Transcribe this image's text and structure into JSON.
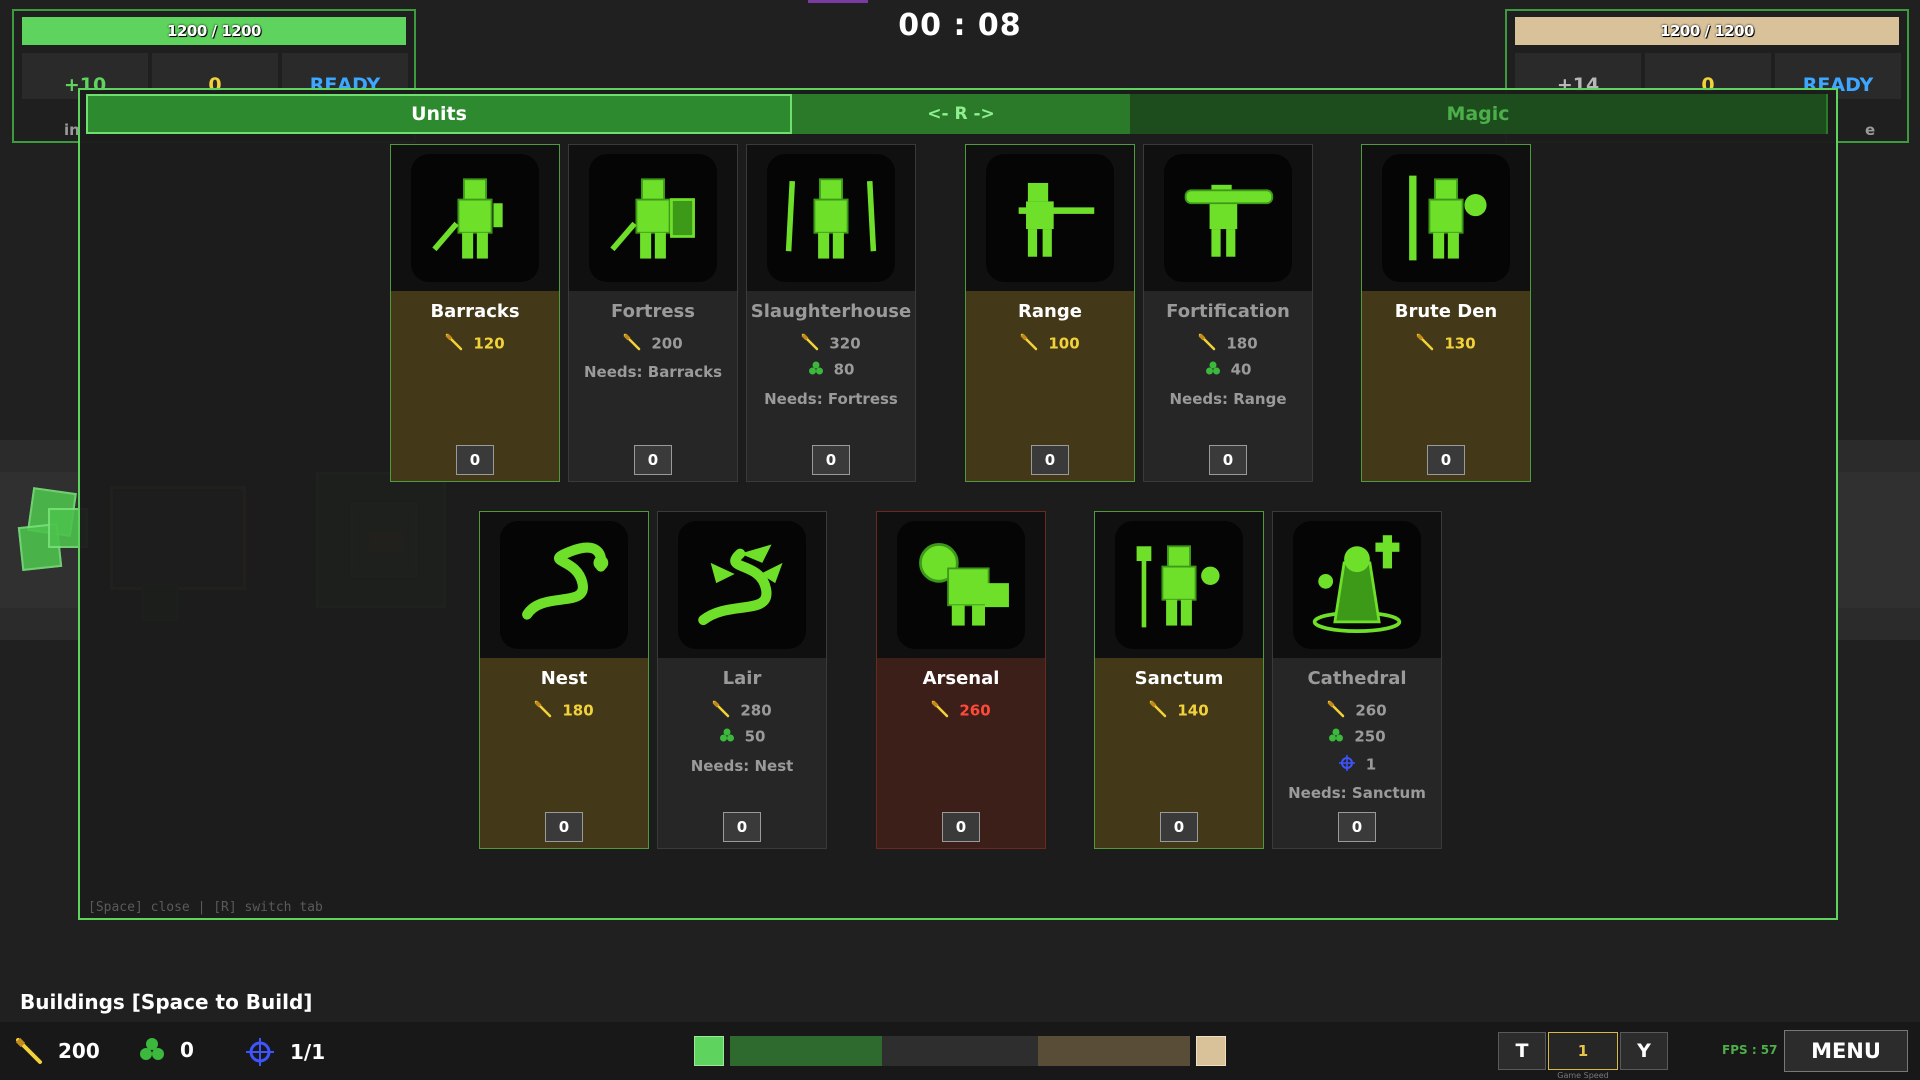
{
  "timer": "00 : 08",
  "player_left": {
    "hp_text": "1200 / 1200",
    "hp_color": "#5ed35e",
    "income": "+10",
    "resource": "0",
    "status": "READY",
    "cut_label": "in"
  },
  "player_right": {
    "hp_text": "1200 / 1200",
    "hp_color": "#d9c29a",
    "income": "+14",
    "resource": "0",
    "status": "READY",
    "cut_label": "e"
  },
  "tabs": {
    "units": "Units",
    "switch": "<- R ->",
    "magic": "Magic"
  },
  "hint": "[Space] close  |  [R] switch tab",
  "cards": [
    {
      "name": "Barracks",
      "gold": "120",
      "count": "0",
      "icon": "swordsman-icon"
    },
    {
      "name": "Fortress",
      "gold": "200",
      "needs": "Needs: Barracks",
      "count": "0",
      "icon": "knight-shield-icon"
    },
    {
      "name": "Slaughterhouse",
      "gold": "320",
      "clover": "80",
      "needs": "Needs: Fortress",
      "count": "0",
      "icon": "dual-blade-warrior-icon"
    },
    {
      "name": "Range",
      "gold": "100",
      "count": "0",
      "icon": "rifleman-icon"
    },
    {
      "name": "Fortification",
      "gold": "180",
      "clover": "40",
      "needs": "Needs: Range",
      "count": "0",
      "icon": "bazooka-soldier-icon"
    },
    {
      "name": "Brute Den",
      "gold": "130",
      "count": "0",
      "icon": "brute-swordsman-icon"
    },
    {
      "name": "Nest",
      "gold": "180",
      "count": "0",
      "icon": "worm-icon"
    },
    {
      "name": "Lair",
      "gold": "280",
      "clover": "50",
      "needs": "Needs: Nest",
      "count": "0",
      "icon": "dragon-serpent-icon"
    },
    {
      "name": "Arsenal",
      "gold": "260",
      "count": "0",
      "icon": "golem-icon"
    },
    {
      "name": "Sanctum",
      "gold": "140",
      "count": "0",
      "icon": "priest-icon"
    },
    {
      "name": "Cathedral",
      "gold": "260",
      "clover": "250",
      "supply": "1",
      "needs": "Needs: Sanctum",
      "count": "0",
      "icon": "cleric-icon"
    }
  ],
  "bottom": {
    "buildings_label": "Buildings  [Space to Build]",
    "gold": "200",
    "clover": "0",
    "supply": "1/1",
    "t_key": "T",
    "speed_value": "1",
    "y_key": "Y",
    "speed_label": "Game Speed",
    "fps": "FPS : 57",
    "menu": "MENU"
  },
  "colors": {
    "gold": "#f2d23a",
    "clover": "#3cb83c",
    "supply": "#3d54ff",
    "unaffordable": "#ff4a3a",
    "accent_green": "#5ed35e"
  }
}
